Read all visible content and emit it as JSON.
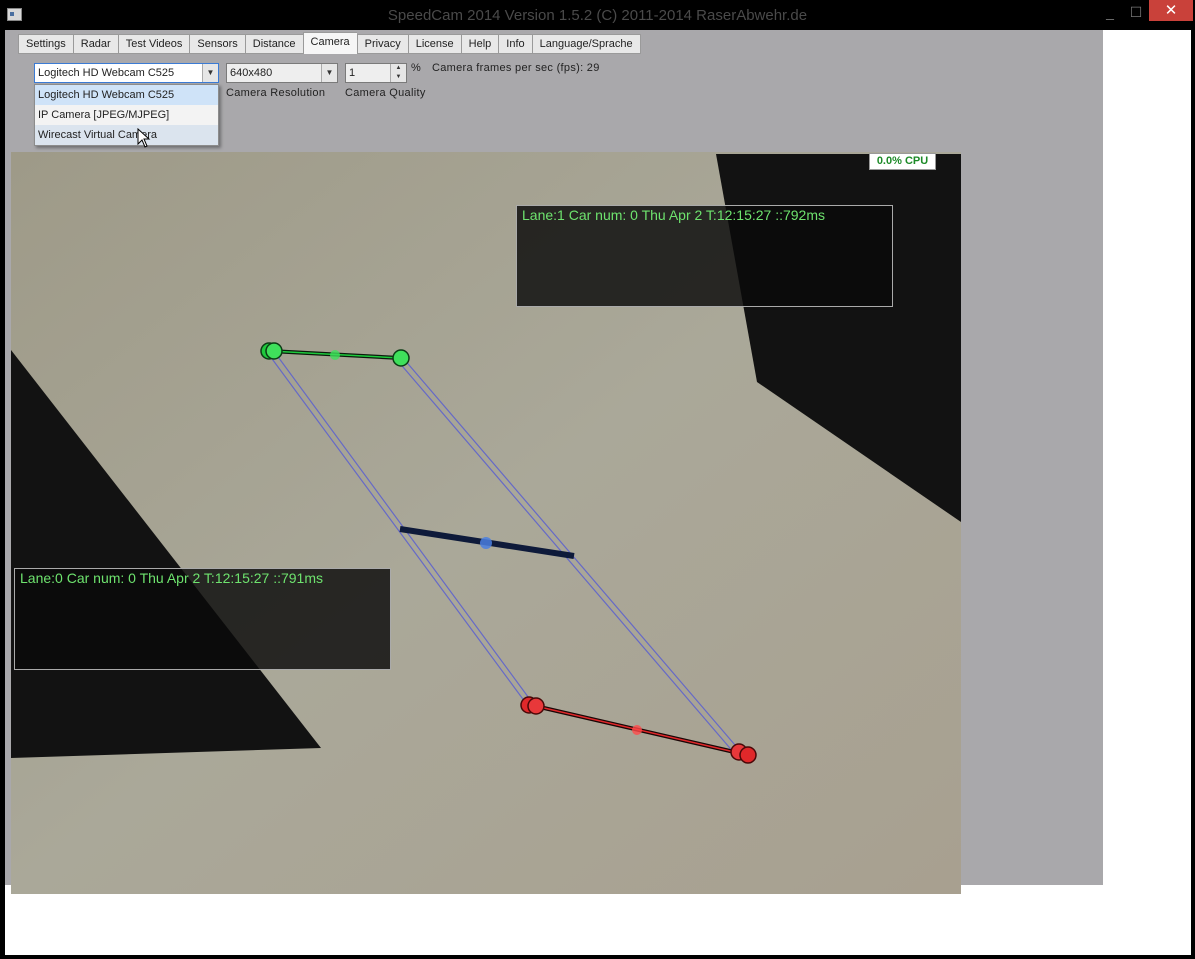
{
  "window": {
    "title": "SpeedCam 2014 Version 1.5.2 (C) 2011-2014 RaserAbwehr.de",
    "minimize_glyph": "_",
    "maximize_glyph": "☐",
    "close_glyph": "✕"
  },
  "tabs": [
    {
      "label": "Settings"
    },
    {
      "label": "Radar"
    },
    {
      "label": "Test Videos"
    },
    {
      "label": "Sensors"
    },
    {
      "label": "Distance"
    },
    {
      "label": "Camera",
      "active": true
    },
    {
      "label": "Privacy"
    },
    {
      "label": "License"
    },
    {
      "label": "Help"
    },
    {
      "label": "Info"
    },
    {
      "label": "Language/Sprache"
    }
  ],
  "camera": {
    "device_selected": "Logitech HD Webcam C525",
    "device_options": [
      "Logitech HD Webcam C525",
      "IP Camera [JPEG/MJPEG]",
      "Wirecast Virtual Camera"
    ],
    "resolution_value": "640x480",
    "resolution_label": "Camera Resolution",
    "quality_value": "1",
    "quality_unit": "%",
    "quality_label": "Camera Quality",
    "fps_text": "Camera frames per sec (fps): 29"
  },
  "video": {
    "cpu_text": "0.0% CPU",
    "lane1_text": "Lane:1 Car num: 0 Thu Apr 2  T:12:15:27 ::792ms",
    "lane0_text": "Lane:0 Car num: 0 Thu Apr 2  T:12:15:27 ::791ms"
  },
  "colors": {
    "start_line": "#1ec93c",
    "end_line": "#e0282a",
    "mid_line": "#0e1a3a",
    "guide": "#5a5fd0",
    "lane_text": "#6ee36e"
  }
}
